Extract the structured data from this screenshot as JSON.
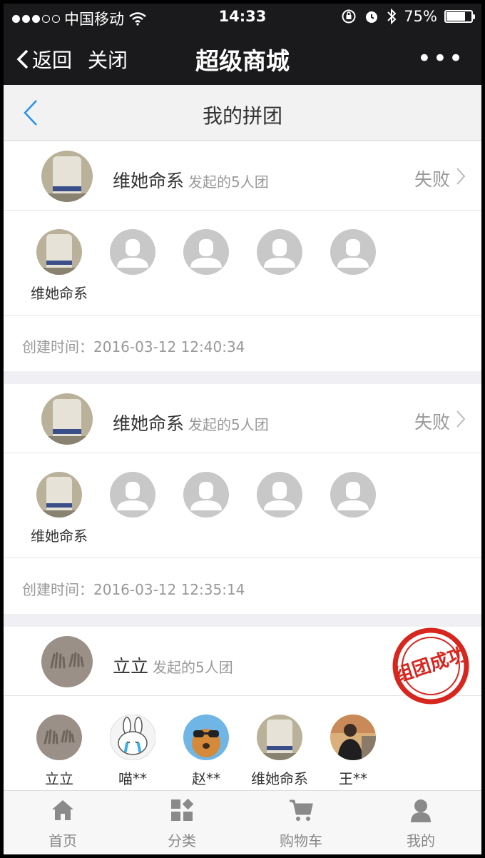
{
  "status_bar": {
    "carrier": "中国移动",
    "time": "14:33",
    "battery": "75%",
    "battery_level": 0.75
  },
  "navbar": {
    "back_label": "返回",
    "close_label": "关闭",
    "title": "超级商城",
    "more_label": "•••"
  },
  "page": {
    "title": "我的拼团"
  },
  "groups": [
    {
      "initiator": "维她命系",
      "desc": "发起的5人团",
      "status": "失败",
      "members": [
        {
          "name": "维她命系",
          "avatar": "bottle-avatar"
        },
        {
          "name": "",
          "avatar": "placeholder-avatar"
        },
        {
          "name": "",
          "avatar": "placeholder-avatar"
        },
        {
          "name": "",
          "avatar": "placeholder-avatar"
        },
        {
          "name": "",
          "avatar": "placeholder-avatar"
        }
      ],
      "created": "创建时间：2016-03-12 12:40:34"
    },
    {
      "initiator": "维她命系",
      "desc": "发起的5人团",
      "status": "失败",
      "members": [
        {
          "name": "维她命系",
          "avatar": "bottle-avatar"
        },
        {
          "name": "",
          "avatar": "placeholder-avatar"
        },
        {
          "name": "",
          "avatar": "placeholder-avatar"
        },
        {
          "name": "",
          "avatar": "placeholder-avatar"
        },
        {
          "name": "",
          "avatar": "placeholder-avatar"
        }
      ],
      "created": "创建时间：2016-03-12 12:35:14"
    },
    {
      "initiator": "立立",
      "desc": "发起的5人团",
      "stamp": "组团成功",
      "members": [
        {
          "name": "立立",
          "avatar": "handprint-avatar"
        },
        {
          "name": "喵**",
          "avatar": "bunny-avatar"
        },
        {
          "name": "赵**",
          "avatar": "dog-avatar"
        },
        {
          "name": "维她命系",
          "avatar": "bottle-avatar"
        },
        {
          "name": "王**",
          "avatar": "person-avatar"
        }
      ]
    }
  ],
  "tabbar": {
    "items": [
      {
        "label": "首页",
        "icon": "home-icon"
      },
      {
        "label": "分类",
        "icon": "category-icon"
      },
      {
        "label": "购物车",
        "icon": "cart-icon"
      },
      {
        "label": "我的",
        "icon": "user-icon"
      }
    ]
  },
  "colors": {
    "accent_blue": "#2a8ff0",
    "stamp_red": "#d7261e",
    "header_bg": "#1a1a1c"
  }
}
